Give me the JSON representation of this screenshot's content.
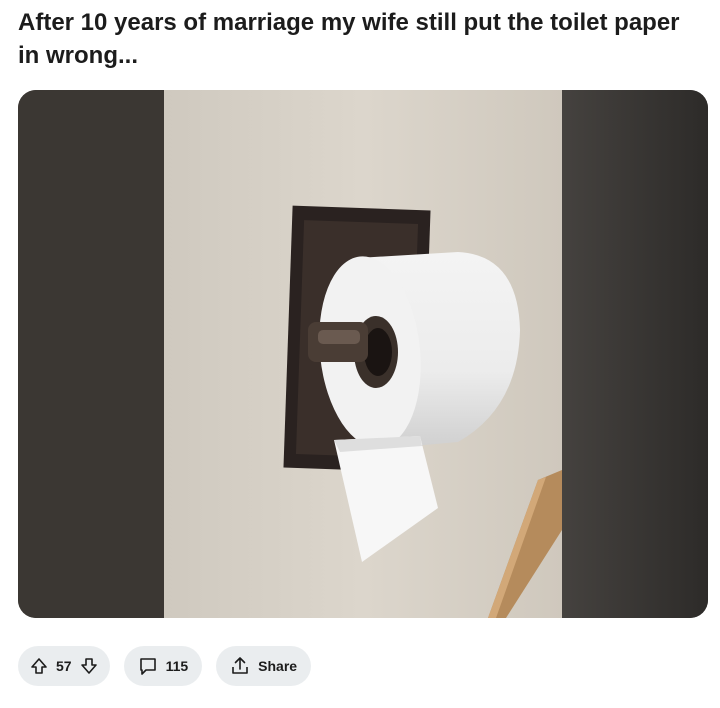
{
  "post": {
    "title": "After 10 years of marriage my wife still put the toilet paper in wrong...",
    "image_alt": "Toilet paper roll on a dark bronze wall-mounted holder"
  },
  "actions": {
    "vote_count": "57",
    "comment_count": "115",
    "share_label": "Share"
  },
  "icons": {
    "upvote": "arrow-up-icon",
    "downvote": "arrow-down-icon",
    "comment": "comment-bubble-icon",
    "share": "share-upload-icon"
  },
  "colors": {
    "pill_bg": "#eaedef",
    "wall": "#d8d2c8",
    "holder": "#2a2220"
  }
}
